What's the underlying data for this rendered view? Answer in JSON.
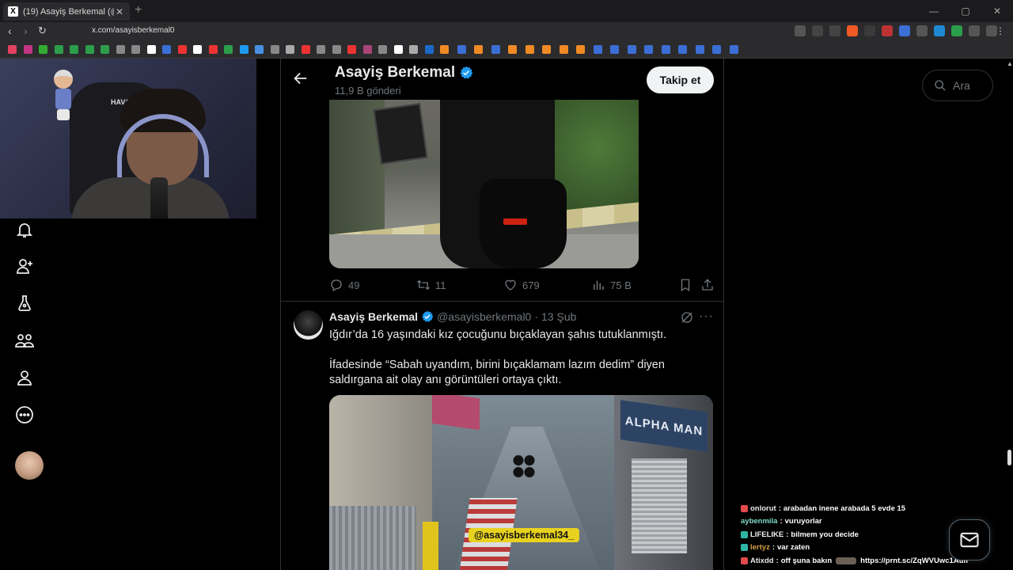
{
  "browser": {
    "tab_title": "(19) Asayiş Berkemal (@asayisbe",
    "tab_favicon": "X",
    "new_tab": "+",
    "url": "x.com/asayisberkemal0",
    "window_controls": [
      "—",
      "▢",
      "✕"
    ]
  },
  "profile": {
    "name": "Asayiş Berkemal",
    "post_count": "11,9 B gönderi",
    "follow_label": "Takip et"
  },
  "post1": {
    "replies": "49",
    "reposts": "11",
    "likes": "679",
    "views": "75 B"
  },
  "post2": {
    "name": "Asayiş Berkemal",
    "handle": "@asayisberkemal0",
    "sep": "·",
    "date": "13 Şub",
    "more": "···",
    "text": "Iğdır’da 16 yaşındaki kız çocuğunu bıçaklayan şahıs tutuklanmıştı.\n\nİfadesinde “Sabah uyandım, birini bıçaklamam lazım dedim” diyen saldırgana ait olay anı görüntüleri ortaya çıktı.",
    "media_watermark": "@asayisberkemal34_",
    "media_sign": "ALPHA MAN"
  },
  "webcam": {
    "chair_logo": "HAVA"
  },
  "search": {
    "placeholder": "Ara"
  },
  "chat": [
    {
      "user": "onlorut",
      "text": "arabadan inene arabada 5 evde 15",
      "color": "#e8e8e8",
      "badge": "#e14a4a"
    },
    {
      "user": "aybenmila",
      "text": "vuruyorlar",
      "color": "#7fdcc7",
      "badge": ""
    },
    {
      "user": "LIFELIKE",
      "text": "bilmem you decide",
      "color": "#f2f2f2",
      "badge": "#2fb5a3"
    },
    {
      "user": "lertyz",
      "text": "var zaten",
      "color": "#d7a24a",
      "badge": "#2fb5a3"
    },
    {
      "user": "Atixdd",
      "text": "off şuna bakın",
      "tail": "https://prnt.sc/ZqWVUwc1Auif",
      "color": "#e8e8e8",
      "badge": "#e14a4a"
    }
  ],
  "colors": {
    "accent": "#1d9bf0",
    "bg": "#000000",
    "muted": "#71767b"
  }
}
